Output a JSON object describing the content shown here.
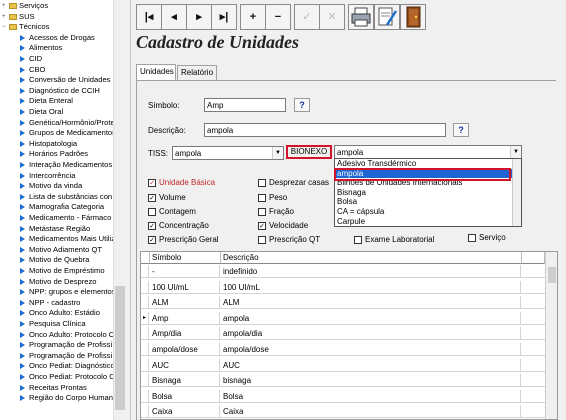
{
  "tree": {
    "items": [
      {
        "label": "Serviços",
        "kind": "root",
        "expander": "+"
      },
      {
        "label": "SUS",
        "kind": "root",
        "expander": "+"
      },
      {
        "label": "Técnicos",
        "kind": "root",
        "expander": "−"
      },
      {
        "label": "Acessos de Drogas",
        "kind": "leaf"
      },
      {
        "label": "Alimentos",
        "kind": "leaf"
      },
      {
        "label": "CID",
        "kind": "leaf"
      },
      {
        "label": "CBO",
        "kind": "leaf"
      },
      {
        "label": "Conversão de Unidades",
        "kind": "leaf"
      },
      {
        "label": "Diagnóstico de CCIH",
        "kind": "leaf"
      },
      {
        "label": "Dieta Enteral",
        "kind": "leaf"
      },
      {
        "label": "Dieta Oral",
        "kind": "leaf"
      },
      {
        "label": "Genética/Hormônio/Prote",
        "kind": "leaf"
      },
      {
        "label": "Grupos de Medicamentos",
        "kind": "leaf"
      },
      {
        "label": "Histopatologia",
        "kind": "leaf"
      },
      {
        "label": "Horários Padrões",
        "kind": "leaf"
      },
      {
        "label": "Interação Medicamentos",
        "kind": "leaf"
      },
      {
        "label": "Intercorrência",
        "kind": "leaf"
      },
      {
        "label": "Motivo da vinda",
        "kind": "leaf"
      },
      {
        "label": "Lista de substâncias con",
        "kind": "leaf"
      },
      {
        "label": "Mamografia Categoria",
        "kind": "leaf"
      },
      {
        "label": "Medicamento - Fármaco",
        "kind": "leaf"
      },
      {
        "label": "Metástase Região",
        "kind": "leaf"
      },
      {
        "label": "Medicamentos Mais Utiliz",
        "kind": "leaf"
      },
      {
        "label": "Motivo Adiamento QT",
        "kind": "leaf"
      },
      {
        "label": "Motivo de Quebra",
        "kind": "leaf"
      },
      {
        "label": "Motivo de Empréstimo",
        "kind": "leaf"
      },
      {
        "label": "Motivo de Desprezo",
        "kind": "leaf"
      },
      {
        "label": "NPP: grupos e elementos",
        "kind": "leaf"
      },
      {
        "label": "NPP - cadastro",
        "kind": "leaf"
      },
      {
        "label": "Onco Adulto: Estádio",
        "kind": "leaf"
      },
      {
        "label": "Pesquisa Clínica",
        "kind": "leaf"
      },
      {
        "label": "Onco Adulto: Protocolo C",
        "kind": "leaf"
      },
      {
        "label": "Programação de Profissi",
        "kind": "leaf"
      },
      {
        "label": "Programação de Profissi",
        "kind": "leaf"
      },
      {
        "label": "Onco Pediat: Diagnóstico",
        "kind": "leaf"
      },
      {
        "label": "Onco Pediat: Protocolo C",
        "kind": "leaf"
      },
      {
        "label": "Receitas Prontas",
        "kind": "leaf"
      },
      {
        "label": "Região do Corpo Humano",
        "kind": "leaf"
      }
    ]
  },
  "toolbar": {
    "first": "|◂",
    "prev": "◂",
    "next": "▸",
    "last": "▸|",
    "add": "+",
    "remove": "−",
    "confirm": "✓",
    "cancel": "✕"
  },
  "title": "Cadastro de Unidades",
  "tabs": [
    "Unidades",
    "Relatório"
  ],
  "form": {
    "simbolo_label": "Símbolo:",
    "simbolo_value": "Amp",
    "help": "?",
    "descricao_label": "Descrição:",
    "descricao_value": "ampola",
    "tiss_label": "TISS:",
    "tiss_value": "ampola",
    "bionexo_label": "BIONEXO",
    "bionexo_value": "ampola"
  },
  "checkboxes": {
    "unidade_basica": {
      "label": "Unidade Básica",
      "checked": true
    },
    "volume": {
      "label": "Volume",
      "checked": true
    },
    "contagem": {
      "label": "Contagem",
      "checked": false
    },
    "concentracao": {
      "label": "Concentração",
      "checked": true
    },
    "prescricao_geral": {
      "label": "Prescrição Geral",
      "checked": true
    },
    "desprezar": {
      "label": "Desprezar casas",
      "checked": false
    },
    "peso": {
      "label": "Peso",
      "checked": false
    },
    "fracao": {
      "label": "Fração",
      "checked": false
    },
    "velocidade": {
      "label": "Velocidade",
      "checked": true
    },
    "prescricao_qt": {
      "label": "Prescrição QT",
      "checked": false
    },
    "exame_lab": {
      "label": "Exame Laboratorial",
      "checked": false
    },
    "servico": {
      "label": "Serviço",
      "checked": false
    }
  },
  "dropdown": {
    "items": [
      "Adesivo Transdérmico",
      "ampola",
      "Bilhões de Unidades Internacionais",
      "Bisnaga",
      "Bolsa",
      "CA = cápsula",
      "Carpule"
    ],
    "selected_index": 1
  },
  "grid": {
    "headers": [
      "Símbolo",
      "Descrição"
    ],
    "rows": [
      {
        "ind": "",
        "simbolo": "-",
        "descricao": "indefinido"
      },
      {
        "ind": "",
        "simbolo": "100 UI/mL",
        "descricao": "100 UI/mL"
      },
      {
        "ind": "",
        "simbolo": "ALM",
        "descricao": "ALM"
      },
      {
        "ind": "▸",
        "simbolo": "Amp",
        "descricao": "ampola"
      },
      {
        "ind": "",
        "simbolo": "Amp/dia",
        "descricao": "ampola/dia"
      },
      {
        "ind": "",
        "simbolo": "ampola/dose",
        "descricao": "ampola/dose"
      },
      {
        "ind": "",
        "simbolo": "AUC",
        "descricao": "AUC"
      },
      {
        "ind": "",
        "simbolo": "Bisnaga",
        "descricao": "bisnaga"
      },
      {
        "ind": "",
        "simbolo": "Bolsa",
        "descricao": "Bolsa"
      },
      {
        "ind": "",
        "simbolo": "Caixa",
        "descricao": "Caixa"
      }
    ]
  },
  "colors": {
    "highlight": "#1e64d2",
    "bionexo_outline": "#d0142a",
    "title": "#222222"
  }
}
